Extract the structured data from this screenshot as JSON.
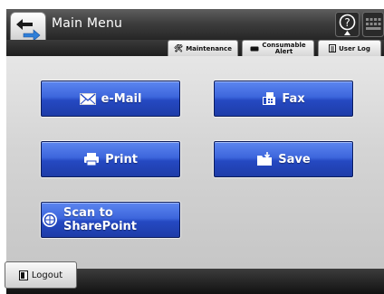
{
  "header": {
    "title": "Main Menu",
    "back_icon": "back-arrow-icon",
    "help_icon": "help-icon",
    "keyboard_icon": "keyboard-icon"
  },
  "tabs": [
    {
      "label": "Maintenance",
      "icon": "tools-icon"
    },
    {
      "label": "Consumable Alert",
      "label_line1": "Consumable",
      "label_line2": "Alert",
      "icon": "consumable-icon"
    },
    {
      "label": "User Log",
      "icon": "document-icon"
    }
  ],
  "menu": {
    "email": {
      "label": "e-Mail",
      "icon": "envelope-icon"
    },
    "fax": {
      "label": "Fax",
      "icon": "fax-icon"
    },
    "print": {
      "label": "Print",
      "icon": "printer-icon"
    },
    "save": {
      "label": "Save",
      "icon": "folder-save-icon"
    },
    "sharepoint": {
      "label": "Scan to SharePoint",
      "icon": "sharepoint-icon"
    }
  },
  "footer": {
    "logout_label": "Logout",
    "logout_icon": "logout-icon"
  },
  "colors": {
    "button_blue": "#2f56d0",
    "header_dark": "#3e3e3e",
    "panel_gray": "#d4d4d4"
  }
}
